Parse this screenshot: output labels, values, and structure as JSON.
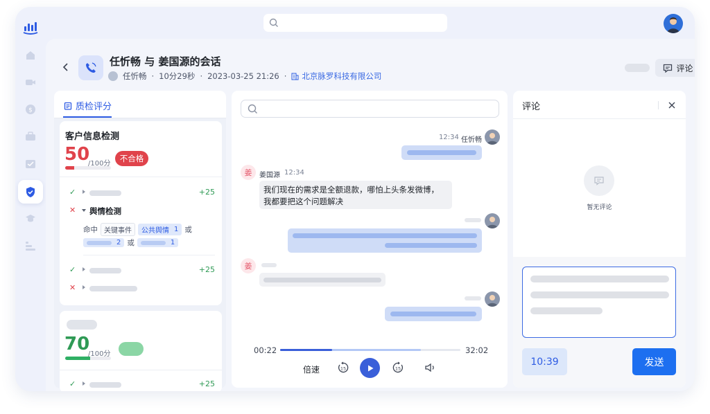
{
  "header": {
    "title": "任忻畅 与 姜国源的会话",
    "agent": "任忻畅",
    "duration": "10分29秒",
    "datetime": "2023-03-25  21:26",
    "company": "北京脉罗科技有限公司",
    "comment_label": "评论"
  },
  "sidebar": {
    "icons": [
      "chart-logo-icon",
      "home-icon",
      "video-icon",
      "coin-icon",
      "briefcase-icon",
      "calendar-icon",
      "shield-check-icon",
      "graduation-cap-icon",
      "bar-list-icon"
    ],
    "active": "shield-check-icon"
  },
  "left": {
    "tab_label": "质检评分",
    "card1": {
      "title": "客户信息检测",
      "score": "50",
      "score_max": "/100分",
      "score_fraction": 0.2,
      "status": "不合格",
      "rows": [
        {
          "mark": "✓",
          "points": "+25"
        },
        {
          "mark": "✕",
          "label": "舆情检测"
        },
        {
          "mark": "✓",
          "points": "+25"
        },
        {
          "mark": "✕"
        }
      ],
      "hit_label": "命中",
      "hit_tag1": "关键事件",
      "hit_tag2": "公共舆情",
      "hit_tag2_count": "1",
      "or1": "或",
      "hit_tag3_count": "2",
      "or2": "或",
      "hit_tag4_count": "1"
    },
    "card2": {
      "score": "70",
      "score_max": "/100分",
      "score_fraction": 0.55,
      "row_points": "+25"
    }
  },
  "chat": {
    "agent_time": "12:34",
    "agent_name": "任忻畅",
    "customer_avatar": "姜",
    "customer_name": "姜国源",
    "customer_time": "12:34",
    "customer_message": "我们现在的需求是全额退款，哪怕上头条发微博，\n我都要把这个问题解决",
    "customer_avatar2": "姜"
  },
  "player": {
    "current": "00:22",
    "total": "32:02",
    "progress": 0.29,
    "buffered": 0.78,
    "speed_label": "倍速",
    "rewind_label": "15",
    "forward_label": "15"
  },
  "comments": {
    "title": "评论",
    "empty": "暂无评论",
    "timestamp": "10:39",
    "send": "发送"
  },
  "colors": {
    "accent": "#2d5be3",
    "danger": "#e0434b",
    "success": "#2f9a55",
    "send": "#1d6ff0"
  }
}
